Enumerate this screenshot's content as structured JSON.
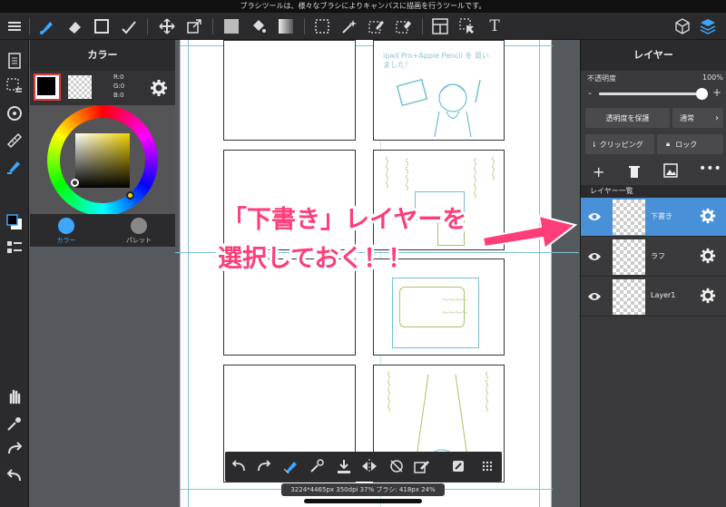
{
  "status_bar": {
    "text": "ブラシツールは、様々なブラシによりキャンバスに描画を行うツールです。"
  },
  "toolbar": {
    "icons": [
      "menu-icon",
      "brush-icon",
      "eraser-icon",
      "rectangle-icon",
      "fill-brush-icon",
      "move-icon",
      "transform-icon",
      "color-fill-icon",
      "bucket-icon",
      "gradient-icon",
      "marquee-icon",
      "magic-wand-icon",
      "select-pen-icon",
      "select-eraser-icon",
      "panel-icon",
      "select-arrow-icon",
      "text-icon",
      "material-icon",
      "layers-icon"
    ],
    "text_tool_glyph": "T"
  },
  "color_panel": {
    "title": "カラー",
    "rgb": {
      "r": "R:0",
      "g": "G:0",
      "b": "B:0"
    },
    "tabs": [
      {
        "label": "カラー",
        "active": true
      },
      {
        "label": "パレット",
        "active": false
      }
    ]
  },
  "layer_panel": {
    "title": "レイヤー",
    "opacity_label": "不透明度",
    "opacity_value": "100%",
    "opacity_fraction": 1.0,
    "minus": "-",
    "plus": "+",
    "protect_alpha": "透明度を保護",
    "blend_mode": "通常",
    "clipping": "クリッピング",
    "lock": "ロック",
    "list_title": "レイヤー一覧",
    "layers": [
      {
        "name": "下書き",
        "selected": true
      },
      {
        "name": "ラフ",
        "selected": false
      },
      {
        "name": "Layer1",
        "selected": false
      }
    ]
  },
  "canvas": {
    "annotation_line1": "「下書き」レイヤーを",
    "annotation_line2": "選択しておく！！",
    "sketch_text_1": "ipad Pro+Apple Pencil を 買いました！",
    "info": "3224*4465px 350dpi 37% ブラシ: 418px 24%"
  },
  "colors": {
    "accent": "#3da7ff",
    "selected_layer": "#4a90d9",
    "annotation": "#ff3d78",
    "current_color": "#000000"
  }
}
